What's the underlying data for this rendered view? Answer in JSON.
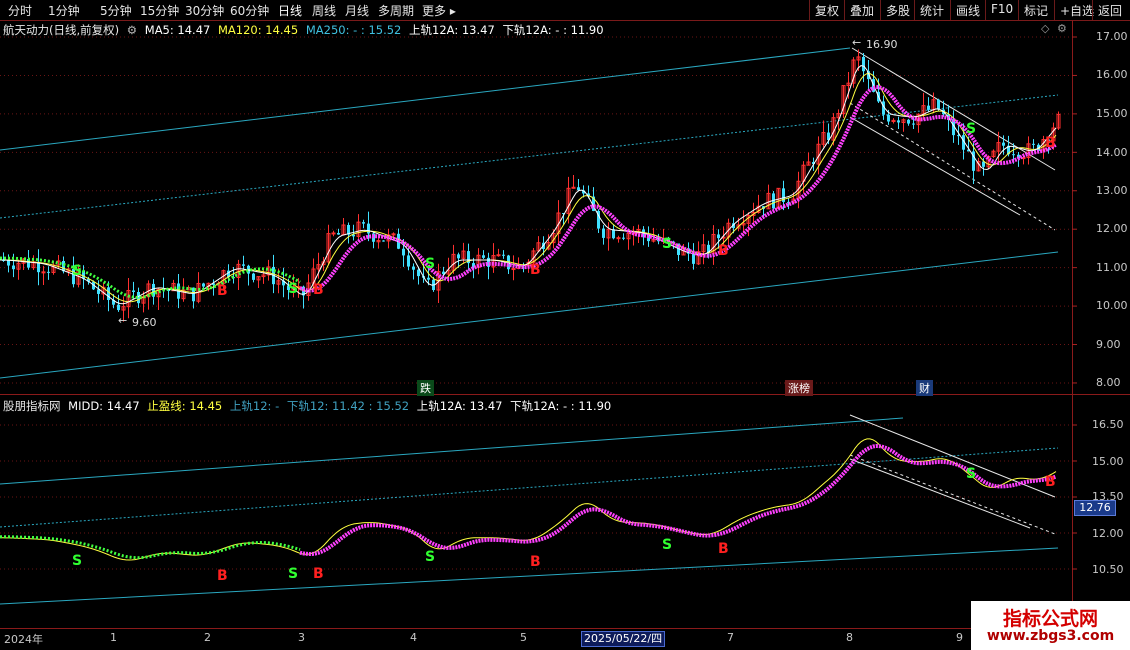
{
  "toolbar": {
    "periods": [
      "分时",
      "1分钟",
      "5分钟",
      "15分钟",
      "30分钟",
      "60分钟",
      "日线",
      "周线",
      "月线",
      "多周期",
      "更多 ▸"
    ],
    "active_period": "日线",
    "buttons": [
      "复权",
      "叠加",
      "多股",
      "统计",
      "画线",
      "F10",
      "标记",
      "+自选",
      "返回"
    ]
  },
  "main_legend": {
    "title": "航天动力(日线,前复权)",
    "ma5": "MA5: 14.47",
    "ma120": "MA120: 14.45",
    "ma250": "MA250: - : 15.52",
    "upper": "上轨12A: 13.47",
    "lower": "下轨12A: - : 11.90"
  },
  "sub_legend": {
    "title": "股朋指标网",
    "midd": "MIDD: 14.47",
    "stop": "止盈线: 14.45",
    "up12": "上轨12: -",
    "down12": "下轨12: 11.42 : 15.52",
    "upper": "上轨12A: 13.47",
    "lower": "下轨12A: - : 11.90"
  },
  "main_axis": [
    "17.00",
    "16.00",
    "15.00",
    "14.00",
    "13.00",
    "12.00",
    "11.00",
    "10.00",
    "9.00",
    "8.00"
  ],
  "sub_axis": [
    "16.50",
    "15.00",
    "13.50",
    "12.00",
    "10.50"
  ],
  "price_box": "12.76",
  "annotations": {
    "high": "16.90",
    "low": "9.60"
  },
  "notes": {
    "die": "跌",
    "zhangbang": "涨榜",
    "cai": "财"
  },
  "x_labels": [
    "2024年",
    "1",
    "2",
    "3",
    "4",
    "5",
    "7",
    "8",
    "9"
  ],
  "cursor_date": "2025/05/22/四",
  "signals": {
    "buy": "B",
    "sell": "S"
  },
  "watermark": {
    "line1": "指标公式网",
    "line2": "www.zbgs3.com"
  },
  "colors": {
    "up": "#ff3030",
    "down": "#40e0ff",
    "ma5": "#ffffff",
    "ma120": "#ffff40",
    "magenta": "#ff40ff",
    "green": "#40ff40",
    "channel": "#2aa8c0"
  }
}
